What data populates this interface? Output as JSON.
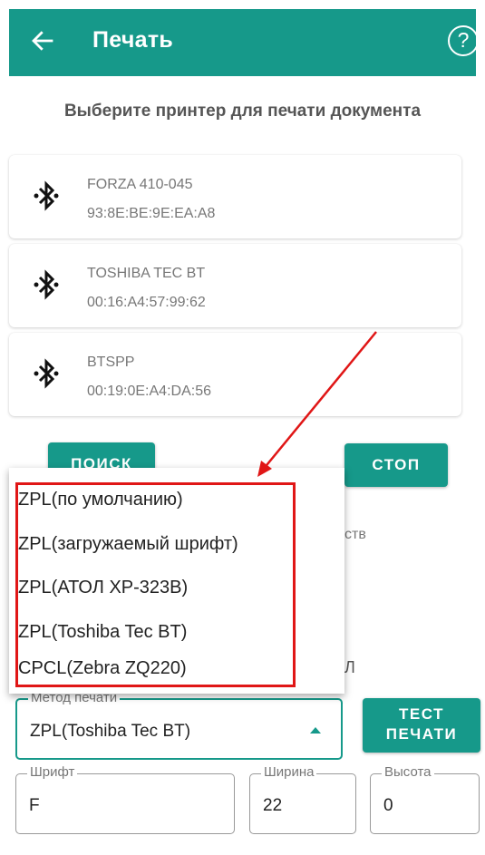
{
  "appbar": {
    "title": "Печать",
    "back_icon": "arrow-left-icon",
    "help_icon": "question-circle-icon",
    "help_glyph": "?"
  },
  "subtitle": "Выберите принтер для печати документа",
  "devices": [
    {
      "name": "FORZA 410-045",
      "mac": "93:8E:BE:9E:EA:A8"
    },
    {
      "name": "TOSHIBA TEC BT",
      "mac": "00:16:A4:57:99:62"
    },
    {
      "name": "BTSPP",
      "mac": "00:19:0E:A4:DA:56"
    }
  ],
  "buttons": {
    "search": "ПОИСК",
    "stop": "СТОП",
    "test_line1": "ТЕСТ",
    "test_line2": "ПЕЧАТИ"
  },
  "partial_text": {
    "devices_tail": "ств",
    "letter": "Л"
  },
  "print_method": {
    "label": "Метод печати",
    "value": "ZPL(Toshiba Tec BT)",
    "options": [
      "ZPL(по умолчанию)",
      "ZPL(загружаемый шрифт)",
      "ZPL(АТОЛ XP-323B)",
      "ZPL(Toshiba Tec BT)",
      "CPCL(Zebra ZQ220)"
    ]
  },
  "font_field": {
    "label": "Шрифт",
    "value": "F"
  },
  "width_field": {
    "label": "Ширина",
    "value": "22"
  },
  "height_field": {
    "label": "Высота",
    "value": "0"
  },
  "colors": {
    "primary": "#16998a",
    "annotation": "#e01616"
  }
}
